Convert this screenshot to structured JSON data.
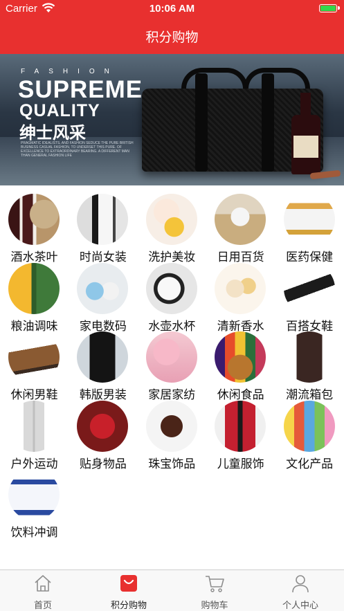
{
  "status_bar": {
    "carrier": "Carrier",
    "time": "10:06 AM"
  },
  "nav": {
    "title": "积分购物"
  },
  "banner": {
    "line1": "FASHION",
    "line2": "SUPREME",
    "line3": "QUALITY",
    "line4": "绅士风采",
    "fine_print": "PRAGMATIC IDEALISTS, AND FASHION SEDUCE THE PURE BRITISH BUSINESS CASUAL FASHION, TO UNDERSET THIS PURE. OF EXCELLENCE TO EXTRAORDINARY BEARING. A DIFFERENT MAN THAN GENERAL FASHION LIFE"
  },
  "categories": [
    {
      "label": "酒水茶叶",
      "thumb": "wine-tea"
    },
    {
      "label": "时尚女装",
      "thumb": "women-fashion"
    },
    {
      "label": "洗护美妆",
      "thumb": "beauty-care"
    },
    {
      "label": "日用百货",
      "thumb": "daily-goods"
    },
    {
      "label": "医药保健",
      "thumb": "health"
    },
    {
      "label": "粮油调味",
      "thumb": "grain-oil"
    },
    {
      "label": "家电数码",
      "thumb": "appliance"
    },
    {
      "label": "水壶水杯",
      "thumb": "cup"
    },
    {
      "label": "清新香水",
      "thumb": "perfume"
    },
    {
      "label": "百搭女鞋",
      "thumb": "women-shoes"
    },
    {
      "label": "休闲男鞋",
      "thumb": "men-shoes"
    },
    {
      "label": "韩版男装",
      "thumb": "men-fashion"
    },
    {
      "label": "家居家纺",
      "thumb": "home-textile"
    },
    {
      "label": "休闲食品",
      "thumb": "snacks"
    },
    {
      "label": "潮流箱包",
      "thumb": "bags"
    },
    {
      "label": "户外运动",
      "thumb": "outdoor"
    },
    {
      "label": "贴身物品",
      "thumb": "intimates"
    },
    {
      "label": "珠宝饰品",
      "thumb": "jewelry"
    },
    {
      "label": "儿童服饰",
      "thumb": "kids"
    },
    {
      "label": "文化产品",
      "thumb": "books"
    },
    {
      "label": "饮料冲调",
      "thumb": "drinks"
    }
  ],
  "tabbar": {
    "tabs": [
      {
        "label": "首页",
        "icon": "home-icon"
      },
      {
        "label": "积分购物",
        "icon": "shopping-bag-icon"
      },
      {
        "label": "购物车",
        "icon": "cart-icon"
      },
      {
        "label": "个人中心",
        "icon": "person-icon"
      }
    ],
    "active_index": 1
  },
  "colors": {
    "brand_red": "#e8302f",
    "battery_green": "#32d74b",
    "tab_active": "#e8302f",
    "tab_inactive": "#8e8e8e"
  }
}
